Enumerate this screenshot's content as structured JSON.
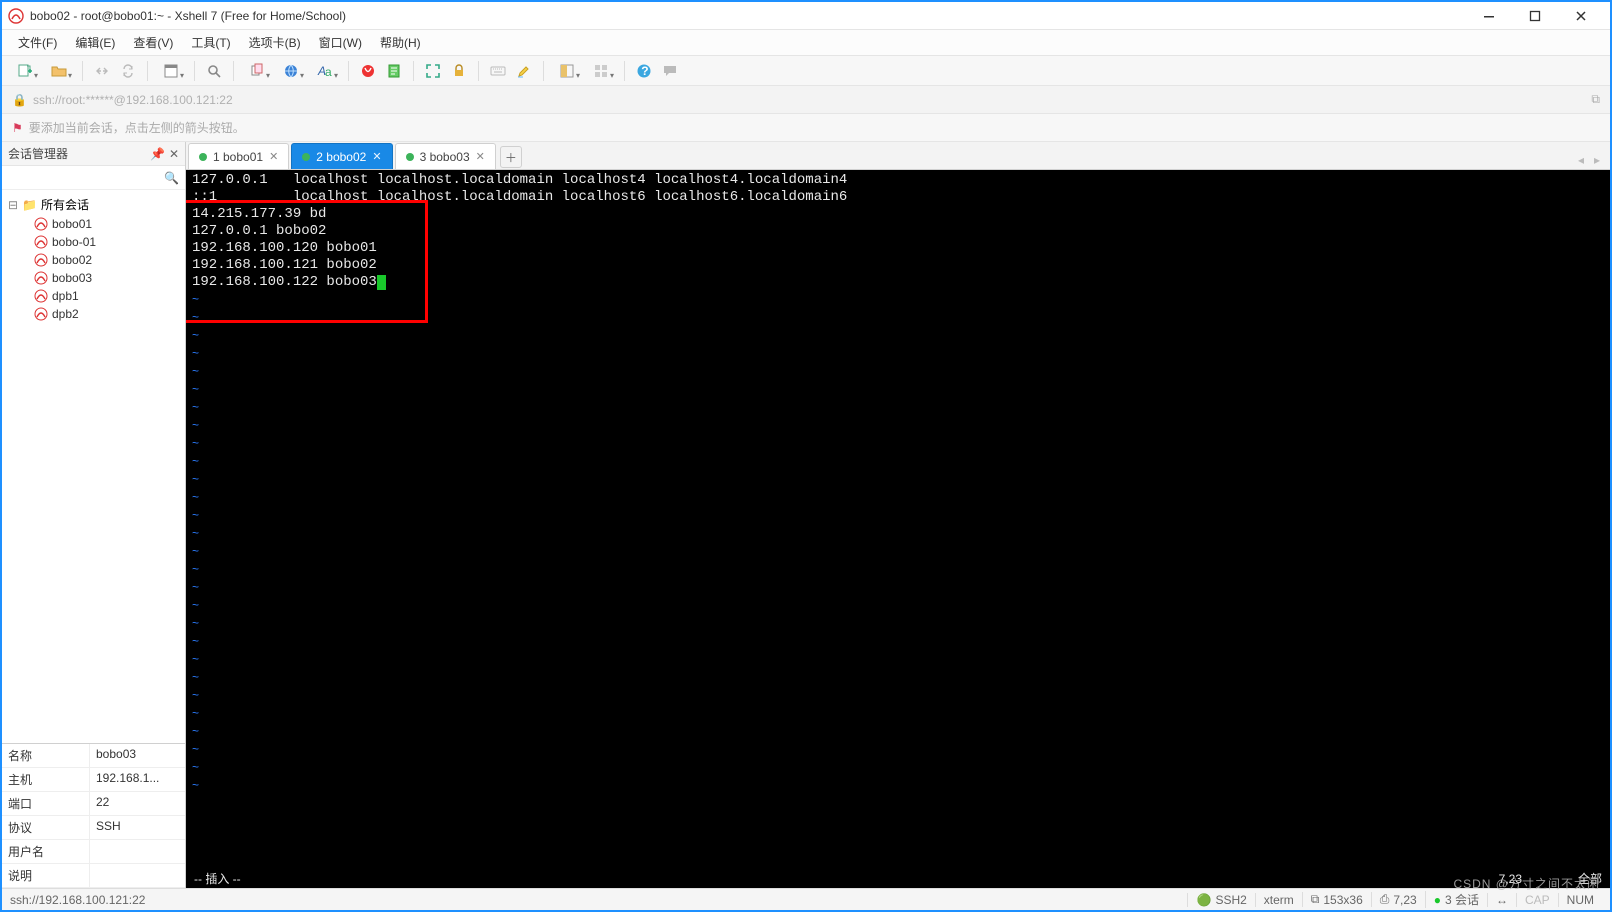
{
  "window": {
    "title": "bobo02 - root@bobo01:~ - Xshell 7 (Free for Home/School)"
  },
  "menu": {
    "file": "文件(F)",
    "edit": "编辑(E)",
    "view": "查看(V)",
    "tools": "工具(T)",
    "tab": "选项卡(B)",
    "window": "窗口(W)",
    "help": "帮助(H)"
  },
  "address": {
    "url": "ssh://root:******@192.168.100.121:22"
  },
  "hint": {
    "text": "要添加当前会话，点击左侧的箭头按钮。"
  },
  "session_manager": {
    "title": "会话管理器",
    "root_label": "所有会话",
    "items": [
      {
        "label": "bobo01"
      },
      {
        "label": "bobo-01"
      },
      {
        "label": "bobo02"
      },
      {
        "label": "bobo03"
      },
      {
        "label": "dpb1"
      },
      {
        "label": "dpb2"
      }
    ],
    "props": [
      {
        "k": "名称",
        "v": "bobo03"
      },
      {
        "k": "主机",
        "v": "192.168.1..."
      },
      {
        "k": "端口",
        "v": "22"
      },
      {
        "k": "协议",
        "v": "SSH"
      },
      {
        "k": "用户名",
        "v": ""
      },
      {
        "k": "说明",
        "v": ""
      }
    ]
  },
  "tabs": [
    {
      "label": "1 bobo01",
      "active": false
    },
    {
      "label": "2 bobo02",
      "active": true
    },
    {
      "label": "3 bobo03",
      "active": false
    }
  ],
  "terminal": {
    "lines_top": [
      "127.0.0.1   localhost localhost.localdomain localhost4 localhost4.localdomain4",
      "::1         localhost localhost.localdomain localhost6 localhost6.localdomain6"
    ],
    "lines_box": [
      "14.215.177.39 bd",
      "127.0.0.1 bobo02",
      "192.168.100.120 bobo01",
      "192.168.100.121 bobo02",
      "192.168.100.122 bobo03"
    ],
    "tilde_rows": 28,
    "status_left": "-- 插入 --",
    "status_pos": "7,23",
    "status_all": "全部"
  },
  "status": {
    "left": "ssh://192.168.100.121:22",
    "ssh": "SSH2",
    "term": "xterm",
    "size_icon": "⧉",
    "size": "153x36",
    "pos_icon": "⎙",
    "pos": "7,23",
    "sess_icon": "●",
    "sess": "3 会话",
    "conn_icon": "↔",
    "cap": "CAP",
    "num": "NUM"
  },
  "watermark": {
    "l1": "CSDN @方寸之间不太闲"
  },
  "colors": {
    "accent": "#1989e6",
    "term_fg": "#e8e8e8",
    "cursor": "#19c82b",
    "tilde": "#2b7cff",
    "redbox": "#ff0000"
  }
}
